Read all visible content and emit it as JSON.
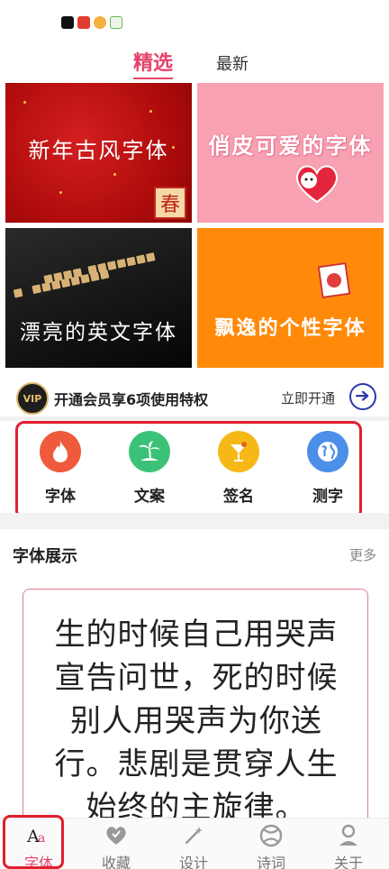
{
  "status_bar": {
    "icons": [
      "tiktok-icon",
      "app-icon-red",
      "weibo-icon",
      "wechat-icon"
    ]
  },
  "tabs": [
    {
      "label": "精选",
      "active": true
    },
    {
      "label": "最新",
      "active": false
    }
  ],
  "banners": [
    {
      "label": "新年古风字体",
      "stamp": "春"
    },
    {
      "label": "俏皮可爱的字体"
    },
    {
      "label": "漂亮的英文字体"
    },
    {
      "label": "飘逸的个性字体"
    }
  ],
  "vip": {
    "badge": "VIP",
    "text": "开通会员享6项使用特权",
    "action": "立即开通"
  },
  "categories": [
    {
      "label": "字体",
      "icon": "flame-icon",
      "color": "#ee5a3b"
    },
    {
      "label": "文案",
      "icon": "palm-island-icon",
      "color": "#3cc277"
    },
    {
      "label": "签名",
      "icon": "cocktail-icon",
      "color": "#f5b817"
    },
    {
      "label": "测字",
      "icon": "globe-icon",
      "color": "#4c8fe8"
    }
  ],
  "showcase_section": {
    "title": "字体展示",
    "more": "更多",
    "lines": [
      "生的时候自己用哭声",
      "宣告问世，死的时候",
      "别人用哭声为你送",
      "行。悲剧是贯穿人生",
      "始终的主旋律。"
    ]
  },
  "bottom_nav": [
    {
      "label": "字体",
      "icon": "font-aa-icon",
      "active": true
    },
    {
      "label": "收藏",
      "icon": "heart-icon",
      "active": false
    },
    {
      "label": "设计",
      "icon": "magic-wand-icon",
      "active": false
    },
    {
      "label": "诗词",
      "icon": "ball-icon",
      "active": false
    },
    {
      "label": "关于",
      "icon": "user-icon",
      "active": false
    }
  ],
  "colors": {
    "accent": "#e4436b",
    "highlight_box": "#e01f2f"
  }
}
